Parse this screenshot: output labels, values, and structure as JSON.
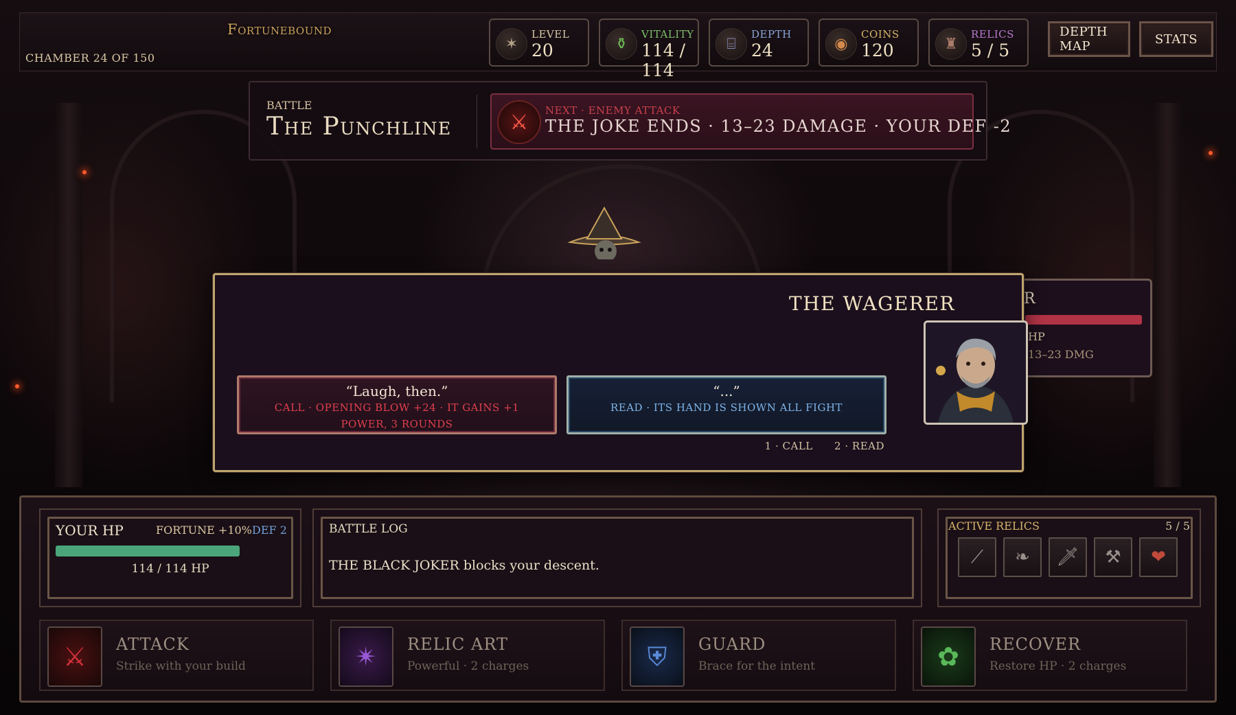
{
  "header": {
    "logo": "Fortunebound",
    "chamber": "CHAMBER 24 OF 150",
    "stats": [
      {
        "label": "LEVEL",
        "value": "20",
        "icon": "star-sigil-icon",
        "label_color": "#d9c8a8"
      },
      {
        "label": "VITALITY",
        "value": "114 / 114",
        "icon": "potion-icon",
        "label_color": "#7fc06a"
      },
      {
        "label": "DEPTH",
        "value": "24",
        "icon": "stairs-icon",
        "label_color": "#8aa6d8"
      },
      {
        "label": "COINS",
        "value": "120",
        "icon": "coin-icon",
        "label_color": "#d4b46a"
      },
      {
        "label": "RELICS",
        "value": "5 / 5",
        "icon": "relic-bag-icon",
        "label_color": "#b87ad0"
      }
    ],
    "buttons": {
      "depth_map": "DEPTH MAP",
      "stats": "STATS"
    }
  },
  "battle": {
    "tag": "BATTLE",
    "name": "The Punchline",
    "intent": {
      "next": "NEXT · ENEMY ATTACK",
      "description": "THE JOKE ENDS  ·  13–23 DAMAGE  ·  YOUR DEF -2",
      "icon": "sword-slash-icon"
    }
  },
  "enemy_card": {
    "name": "R",
    "hp": "HP",
    "damage": "13–23 DMG"
  },
  "dialog": {
    "speaker": "THE WAGERER",
    "choices": [
      {
        "quote": "“Laugh, then.”",
        "effect": "CALL  ·  OPENING BLOW +24  ·  IT GAINS +1 POWER, 3 ROUNDS"
      },
      {
        "quote": "“...”",
        "effect": "READ  ·  ITS HAND IS SHOWN ALL FIGHT"
      }
    ],
    "hotkeys": [
      "1 · CALL",
      "2 · READ"
    ]
  },
  "player": {
    "title": "YOUR HP",
    "fortune": "FORTUNE +10%",
    "def": "DEF 2",
    "hp_text": "114 / 114 HP",
    "hp_fraction": 1.0
  },
  "battle_log": {
    "title": "BATTLE LOG",
    "entry": "THE BLACK JOKER blocks your descent."
  },
  "relics": {
    "title": "ACTIVE RELICS",
    "count": "5 / 5",
    "items": [
      "staff-icon",
      "feather-icon",
      "dagger-icon",
      "axe-icon",
      "heart-icon"
    ]
  },
  "actions": [
    {
      "name": "ATTACK",
      "desc": "Strike with your build",
      "icon": "sword-icon"
    },
    {
      "name": "RELIC ART",
      "desc": "Powerful · 2 charges",
      "icon": "arcane-star-icon"
    },
    {
      "name": "GUARD",
      "desc": "Brace for the intent",
      "icon": "shield-icon"
    },
    {
      "name": "RECOVER",
      "desc": "Restore HP · 2 charges",
      "icon": "herb-icon"
    }
  ]
}
